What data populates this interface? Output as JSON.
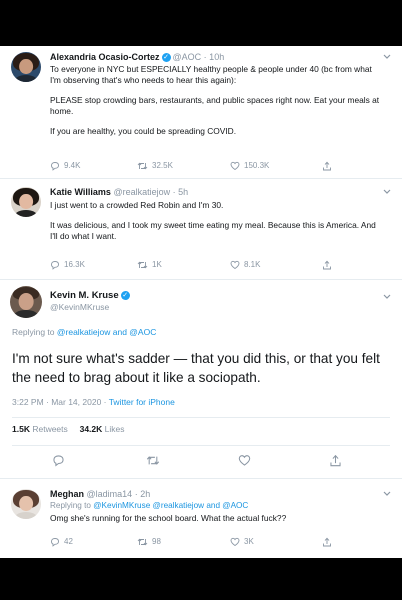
{
  "tweets": [
    {
      "name": "Alexandria Ocasio-Cortez",
      "handle": "@AOC · 10h",
      "lines": [
        "To everyone in NYC but ESPECIALLY healthy people & people under 40 (bc from what I'm observing that's who needs to hear this again):",
        "PLEASE stop crowding bars, restaurants, and public spaces right now. Eat your meals at home.",
        "If you are healthy, you could be spreading COVID."
      ],
      "replies": "9.4K",
      "retweets": "32.5K",
      "likes": "150.3K"
    },
    {
      "name": "Katie Williams",
      "handle": "@realkatiejow · 5h",
      "lines": [
        "I just went to a crowded Red Robin and I'm 30.",
        "It was delicious, and I took my sweet time eating my meal. Because this is America. And I'll do what I want."
      ],
      "replies": "16.3K",
      "retweets": "1K",
      "likes": "8.1K"
    }
  ],
  "main_tweet": {
    "name": "Kevin M. Kruse",
    "handle": "@KevinMKruse",
    "replying_prefix": "Replying to ",
    "replying_to": "@realkatiejow and @AOC",
    "text": "I'm not sure what's sadder — that you did this, or that you felt the need to brag about it like a sociopath.",
    "time": "3:22 PM · Mar 14, 2020 · ",
    "source": "Twitter for iPhone",
    "retweets_count": "1.5K",
    "retweets_label": "Retweets",
    "likes_count": "34.2K",
    "likes_label": "Likes"
  },
  "reply": {
    "name": "Meghan",
    "handle": "@ladima14 · 2h",
    "replying_prefix": "Replying to ",
    "replying_to": "@KevinMKruse @realkatiejow and @AOC",
    "text": "Omg she's running for the school board. What the actual fuck??",
    "replies": "42",
    "retweets": "98",
    "likes": "3K"
  }
}
